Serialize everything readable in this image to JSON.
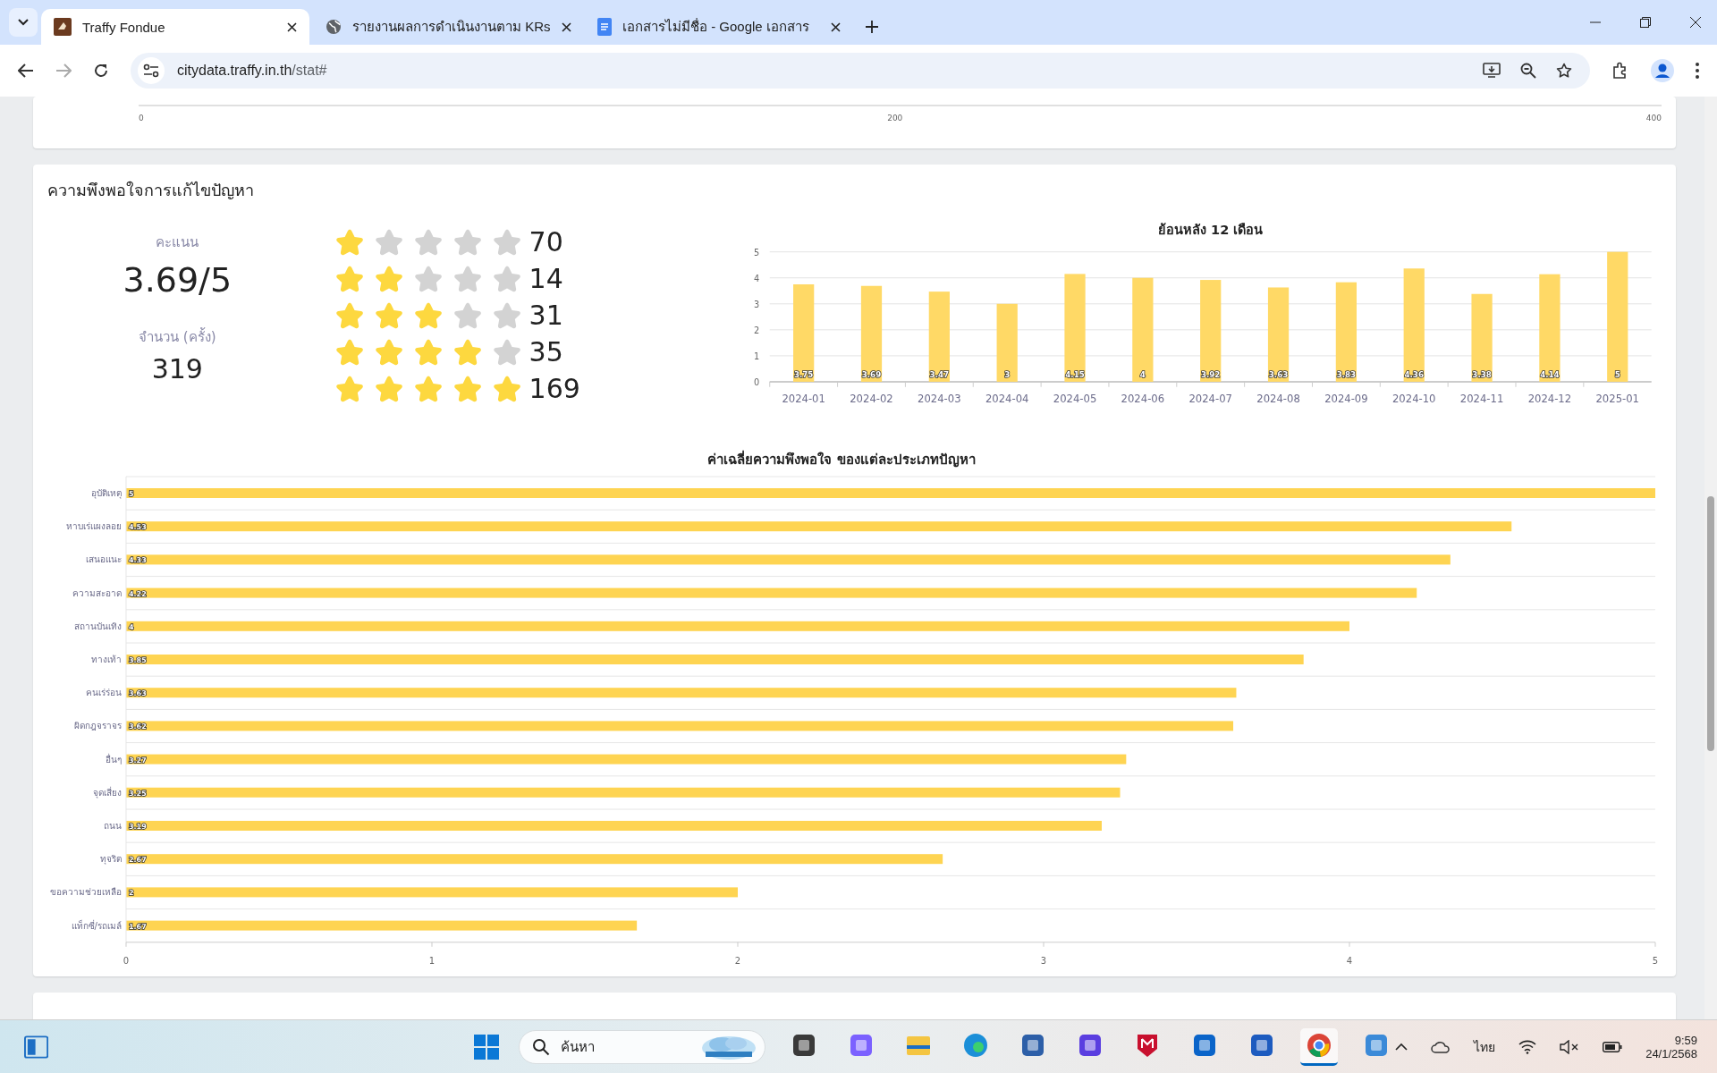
{
  "browser": {
    "tabs": [
      {
        "title": "Traffy Fondue",
        "selected": true
      },
      {
        "title": "รายงานผลการดำเนินงานตาม KRs",
        "selected": false
      },
      {
        "title": "เอกสารไม่มีชื่อ - Google เอกสาร",
        "selected": false
      }
    ],
    "address": {
      "host": "citydata.traffy.in.th",
      "path": "/stat#"
    }
  },
  "top_card": {
    "axis_ticks": [
      "0",
      "200",
      "400"
    ]
  },
  "satisfaction": {
    "title": "ความพึงพอใจการแก้ไขปัญหา",
    "score_label": "คะแนน",
    "score": "3.69/5",
    "count_label": "จำนวน (ครั้ง)",
    "count": "319",
    "ratings": [
      {
        "stars": 1,
        "count": "70"
      },
      {
        "stars": 2,
        "count": "14"
      },
      {
        "stars": 3,
        "count": "31"
      },
      {
        "stars": 4,
        "count": "35"
      },
      {
        "stars": 5,
        "count": "169"
      }
    ],
    "monthly": {
      "chart_data": {
        "type": "bar",
        "title": "ย้อนหลัง 12 เดือน",
        "categories": [
          "2024-01",
          "2024-02",
          "2024-03",
          "2024-04",
          "2024-05",
          "2024-06",
          "2024-07",
          "2024-08",
          "2024-09",
          "2024-10",
          "2024-11",
          "2024-12",
          "2025-01"
        ],
        "values": [
          3.75,
          3.69,
          3.47,
          3,
          4.15,
          4,
          3.92,
          3.63,
          3.83,
          4.36,
          3.38,
          4.14,
          5
        ],
        "ylim": [
          0,
          5
        ],
        "yticks": [
          0,
          1,
          2,
          3,
          4,
          5
        ],
        "grid": true,
        "data_labels": true
      }
    },
    "by_type": {
      "chart_data": {
        "type": "bar",
        "orientation": "horizontal",
        "title": "ค่าเฉลี่ยความพึงพอใจ ของแต่ละประเภทปัญหา",
        "categories": [
          "อุบัติเหตุ",
          "หาบเร่แผงลอย",
          "เสนอแนะ",
          "ความสะอาด",
          "สถานบันเทิง",
          "ทางเท้า",
          "คนเร่ร่อน",
          "ผิดกฎจราจร",
          "อื่นๆ",
          "จุดเสี่ยง",
          "ถนน",
          "ทุจริต",
          "ขอความช่วยเหลือ",
          "แท็กซี่/รถเมล์"
        ],
        "values": [
          5,
          4.53,
          4.33,
          4.22,
          4,
          3.85,
          3.63,
          3.62,
          3.27,
          3.25,
          3.19,
          2.67,
          2,
          1.67
        ],
        "xlim": [
          0,
          5
        ],
        "xticks": [
          0,
          1,
          2,
          3,
          4,
          5
        ],
        "data_labels": true
      }
    }
  },
  "taskbar": {
    "search_placeholder": "ค้นหา",
    "language": "ไทย",
    "time": "9:59",
    "date": "24/1/2568",
    "apps": [
      {
        "kind": "files",
        "active": false
      },
      {
        "kind": "copilot",
        "active": false
      },
      {
        "kind": "explorer",
        "active": false
      },
      {
        "kind": "edge",
        "active": false
      },
      {
        "kind": "store",
        "active": false
      },
      {
        "kind": "ai",
        "active": false
      },
      {
        "kind": "shield",
        "active": false
      },
      {
        "kind": "outlook",
        "active": false
      },
      {
        "kind": "word",
        "active": false
      },
      {
        "kind": "chrome",
        "active": true
      },
      {
        "kind": "photos",
        "active": false
      }
    ]
  }
}
